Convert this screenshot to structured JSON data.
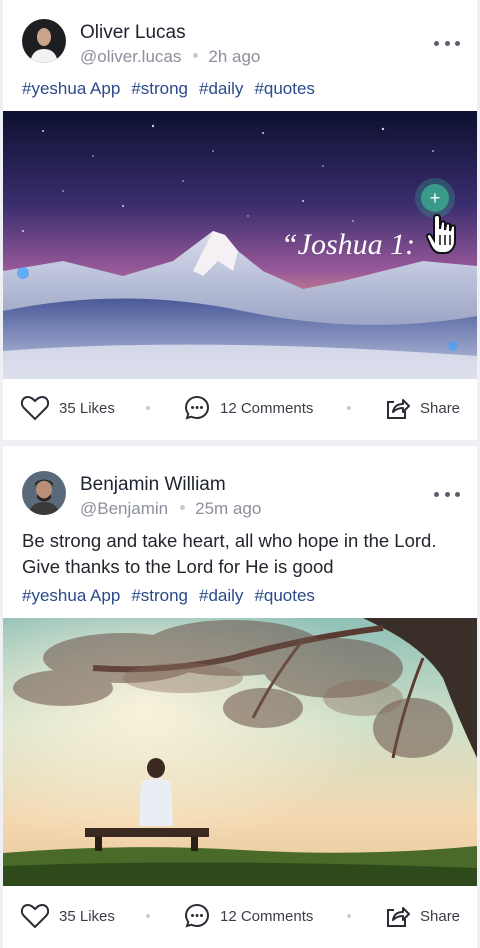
{
  "posts": [
    {
      "author_name": "Oliver Lucas",
      "handle": "@oliver.lucas",
      "time": "2h ago",
      "text": "",
      "tags": [
        "#yeshua App",
        "#strong",
        "#daily",
        "#quotes"
      ],
      "image_quote": "“Joshua 1:",
      "likes_label": "35 Likes",
      "comments_label": "12 Comments",
      "share_label": "Share"
    },
    {
      "author_name": "Benjamin William",
      "handle": "@Benjamin",
      "time": "25m ago",
      "text": "Be strong and take heart, all who hope in the Lord. Give thanks to the Lord for He is good",
      "tags": [
        "#yeshua App",
        "#strong",
        "#daily",
        "#quotes"
      ],
      "likes_label": "35 Likes",
      "comments_label": "12 Comments",
      "share_label": "Share"
    }
  ],
  "overlay": {
    "add_button_label": "+"
  },
  "icons": {
    "more": "more-horizontal-icon",
    "like": "heart-icon",
    "comment": "comment-bubble-icon",
    "share": "share-icon",
    "cursor": "hand-pointer-icon"
  },
  "colors": {
    "tag": "#2b4a8a",
    "add_button": "#3a9a8a"
  }
}
